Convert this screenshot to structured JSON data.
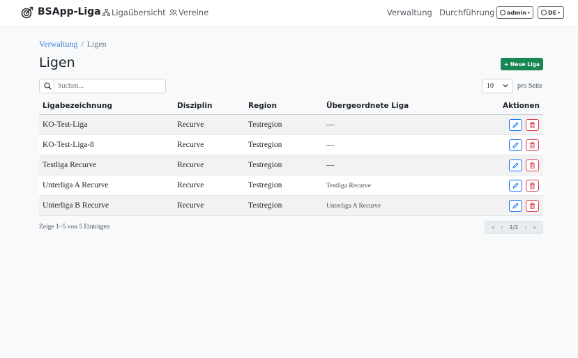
{
  "navbar": {
    "brand": "BSApp-Liga",
    "links": [
      {
        "label": "Ligaübersicht",
        "icon": "hierarchy-icon"
      },
      {
        "label": "Vereine",
        "icon": "users-icon"
      }
    ],
    "right_links": [
      "Verwaltung",
      "Durchführung"
    ],
    "user_label": "admin",
    "lang_label": "DE"
  },
  "breadcrumb": {
    "parent": "Verwaltung",
    "separator": "/",
    "current": "Ligen"
  },
  "page_title": "Ligen",
  "new_button_label": "+ Neue Liga",
  "search": {
    "placeholder": "Suchen...",
    "value": ""
  },
  "page_size": {
    "value": "10",
    "suffix": "pro Seite"
  },
  "table": {
    "headers": [
      "Ligabezeichnung",
      "Disziplin",
      "Region",
      "Übergeordnete Liga",
      "Aktionen"
    ],
    "rows": [
      {
        "name": "KO-Test-Liga",
        "discipline": "Recurve",
        "region": "Testregion",
        "parent": "—"
      },
      {
        "name": "KO-Test-Liga-8",
        "discipline": "Recurve",
        "region": "Testregion",
        "parent": "—"
      },
      {
        "name": "Testliga Recurve",
        "discipline": "Recurve",
        "region": "Testregion",
        "parent": "—"
      },
      {
        "name": "Unterliga A Recurve",
        "discipline": "Recurve",
        "region": "Testregion",
        "parent": "Testliga Recurve"
      },
      {
        "name": "Unterliga B Recurve",
        "discipline": "Recurve",
        "region": "Testregion",
        "parent": "Unterliga A Recurve"
      }
    ]
  },
  "summary": "Zeige 1–5 von 5 Einträgen",
  "pagination": {
    "first": "«",
    "prev": "‹",
    "current": "1/1",
    "next": "›",
    "last": "»"
  },
  "colors": {
    "primary": "#0d6efd",
    "success": "#198754",
    "danger": "#dc3545",
    "link": "#3a7bd5"
  }
}
